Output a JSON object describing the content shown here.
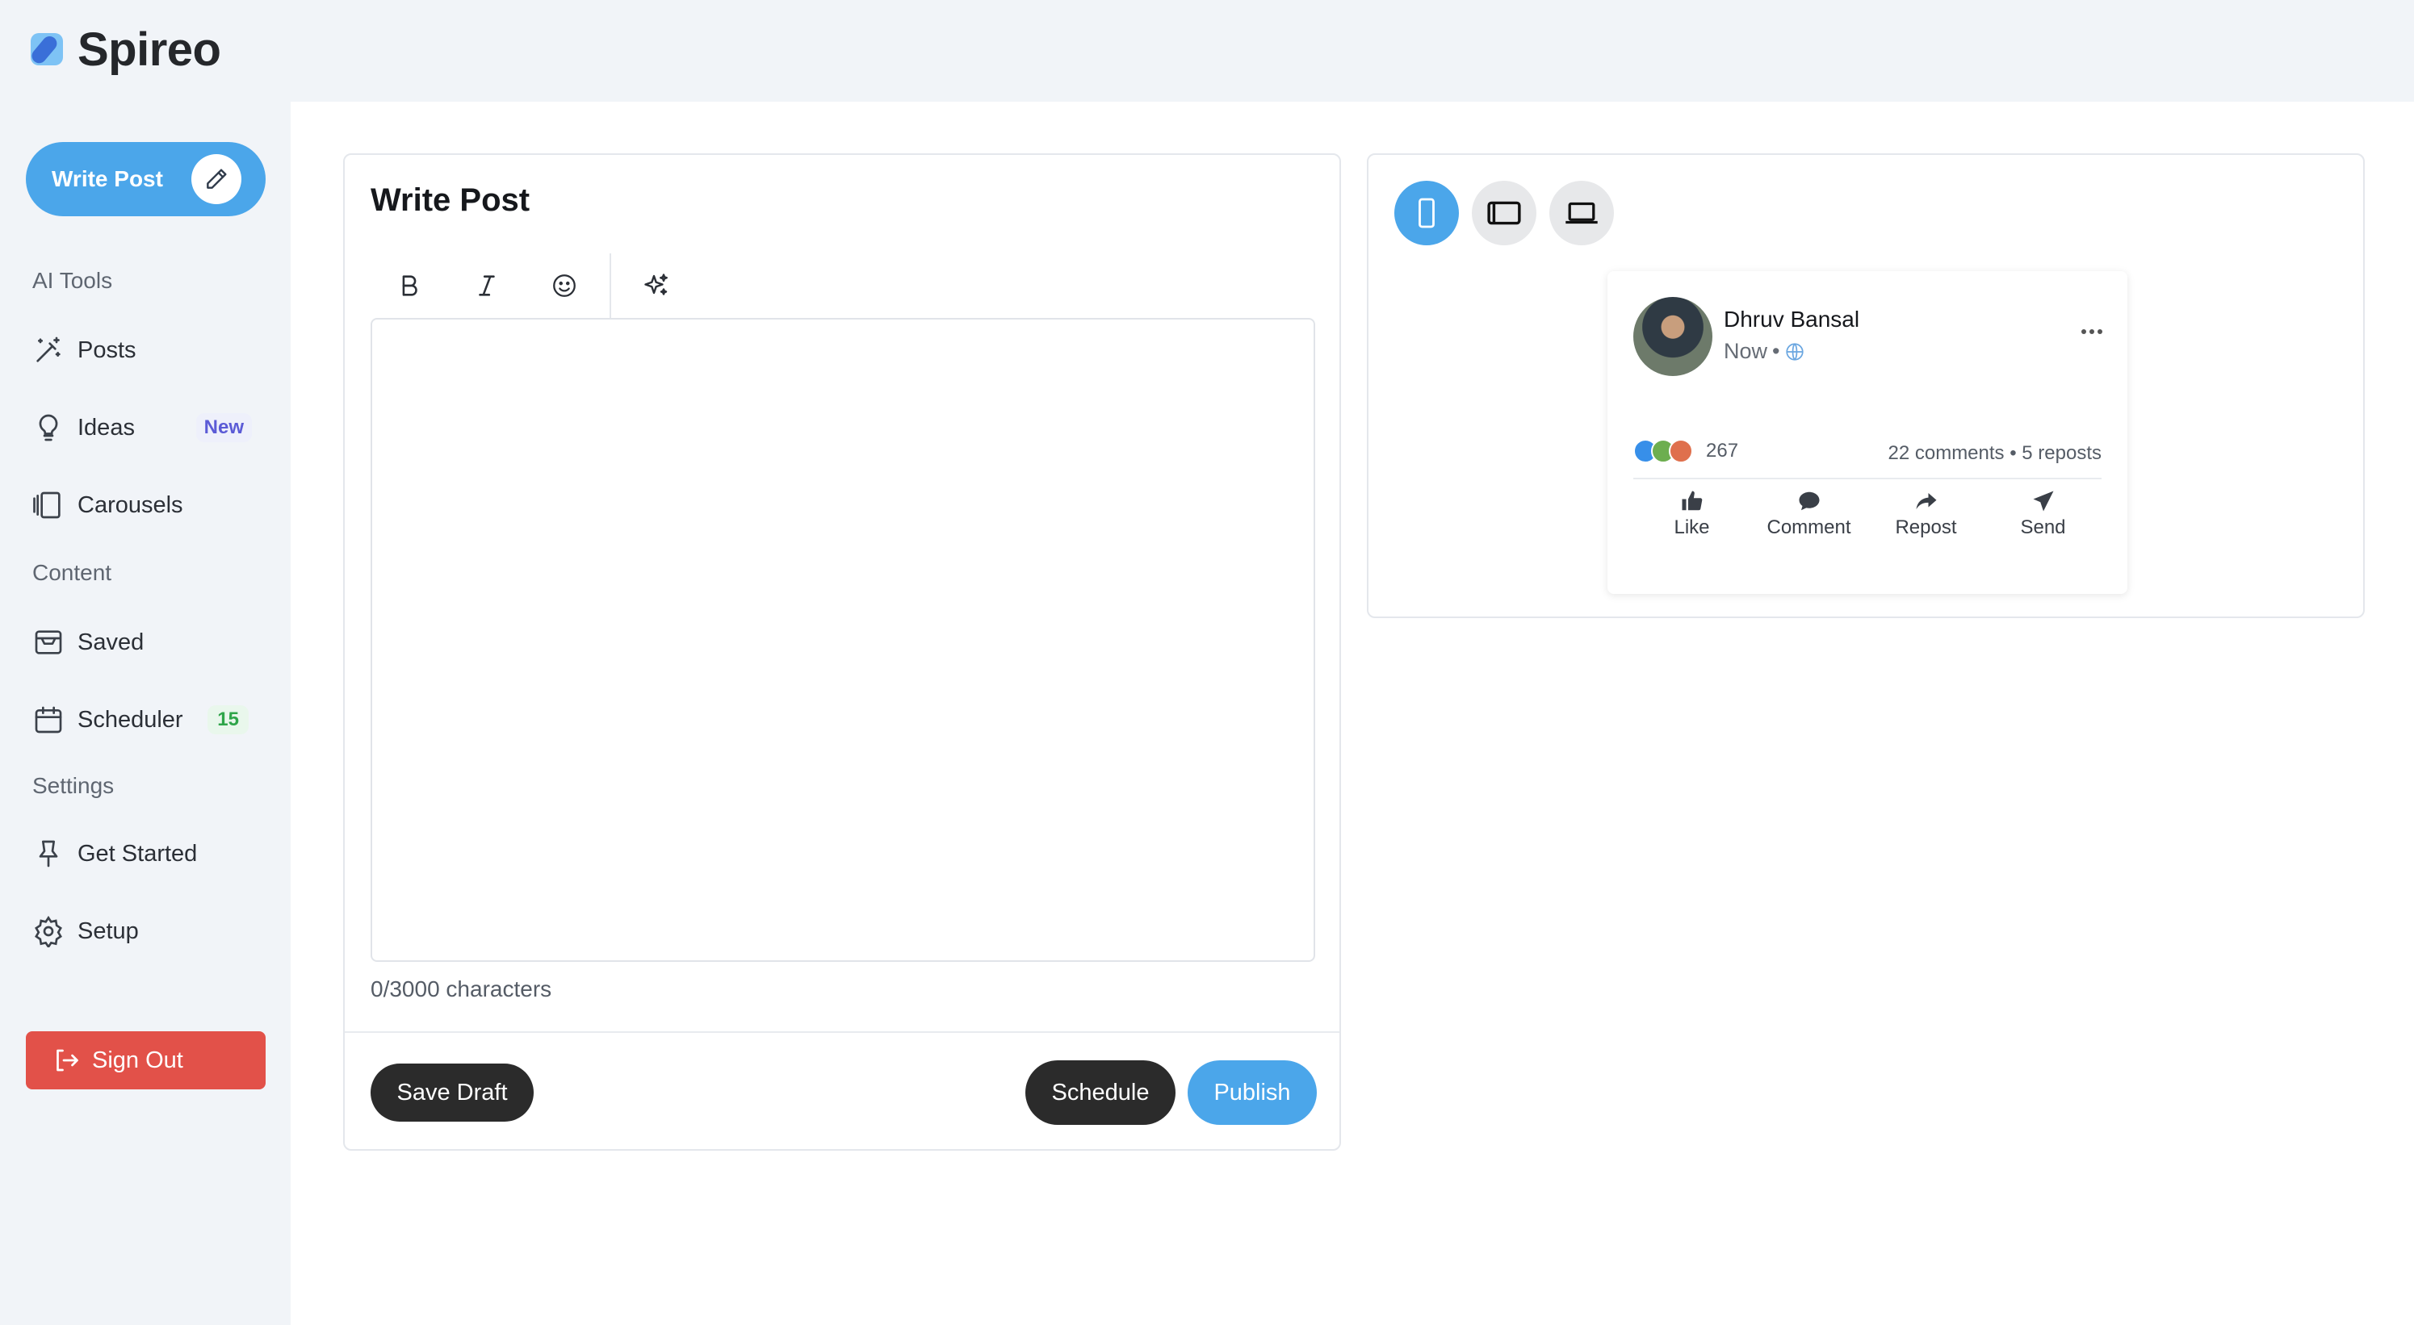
{
  "app": {
    "name": "Spireo"
  },
  "colors": {
    "accent": "#4ba6ea",
    "danger": "#e25149",
    "dark_button": "#2b2b2b"
  },
  "sidebar": {
    "write_post_label": "Write Post",
    "sections": [
      {
        "label": "AI Tools",
        "items": [
          {
            "label": "Posts",
            "icon": "magic-wand-icon"
          },
          {
            "label": "Ideas",
            "icon": "lightbulb-icon",
            "badge": "New"
          },
          {
            "label": "Carousels",
            "icon": "carousel-icon"
          }
        ]
      },
      {
        "label": "Content",
        "items": [
          {
            "label": "Saved",
            "icon": "inbox-icon"
          },
          {
            "label": "Scheduler",
            "icon": "calendar-icon",
            "badge": "15"
          }
        ]
      },
      {
        "label": "Settings",
        "items": [
          {
            "label": "Get Started",
            "icon": "pin-icon"
          },
          {
            "label": "Setup",
            "icon": "gear-icon"
          }
        ]
      }
    ],
    "sign_out_label": "Sign Out"
  },
  "editor": {
    "title": "Write Post",
    "toolbar": [
      "bold-icon",
      "italic-icon",
      "emoji-icon",
      "sparkle-icon"
    ],
    "content": "",
    "char_count": "0/3000 characters",
    "save_draft_label": "Save Draft",
    "schedule_label": "Schedule",
    "publish_label": "Publish"
  },
  "preview": {
    "devices": [
      {
        "icon": "mobile-icon",
        "active": true
      },
      {
        "icon": "tablet-icon",
        "active": false
      },
      {
        "icon": "laptop-icon",
        "active": false
      }
    ],
    "post": {
      "author": "Dhruv Bansal",
      "time": "Now",
      "separator": "•",
      "reaction_count": "267",
      "stats": "22 comments • 5 reposts",
      "actions": [
        {
          "label": "Like",
          "icon": "thumbs-up-icon"
        },
        {
          "label": "Comment",
          "icon": "comment-icon"
        },
        {
          "label": "Repost",
          "icon": "repost-icon"
        },
        {
          "label": "Send",
          "icon": "send-icon"
        }
      ]
    }
  }
}
